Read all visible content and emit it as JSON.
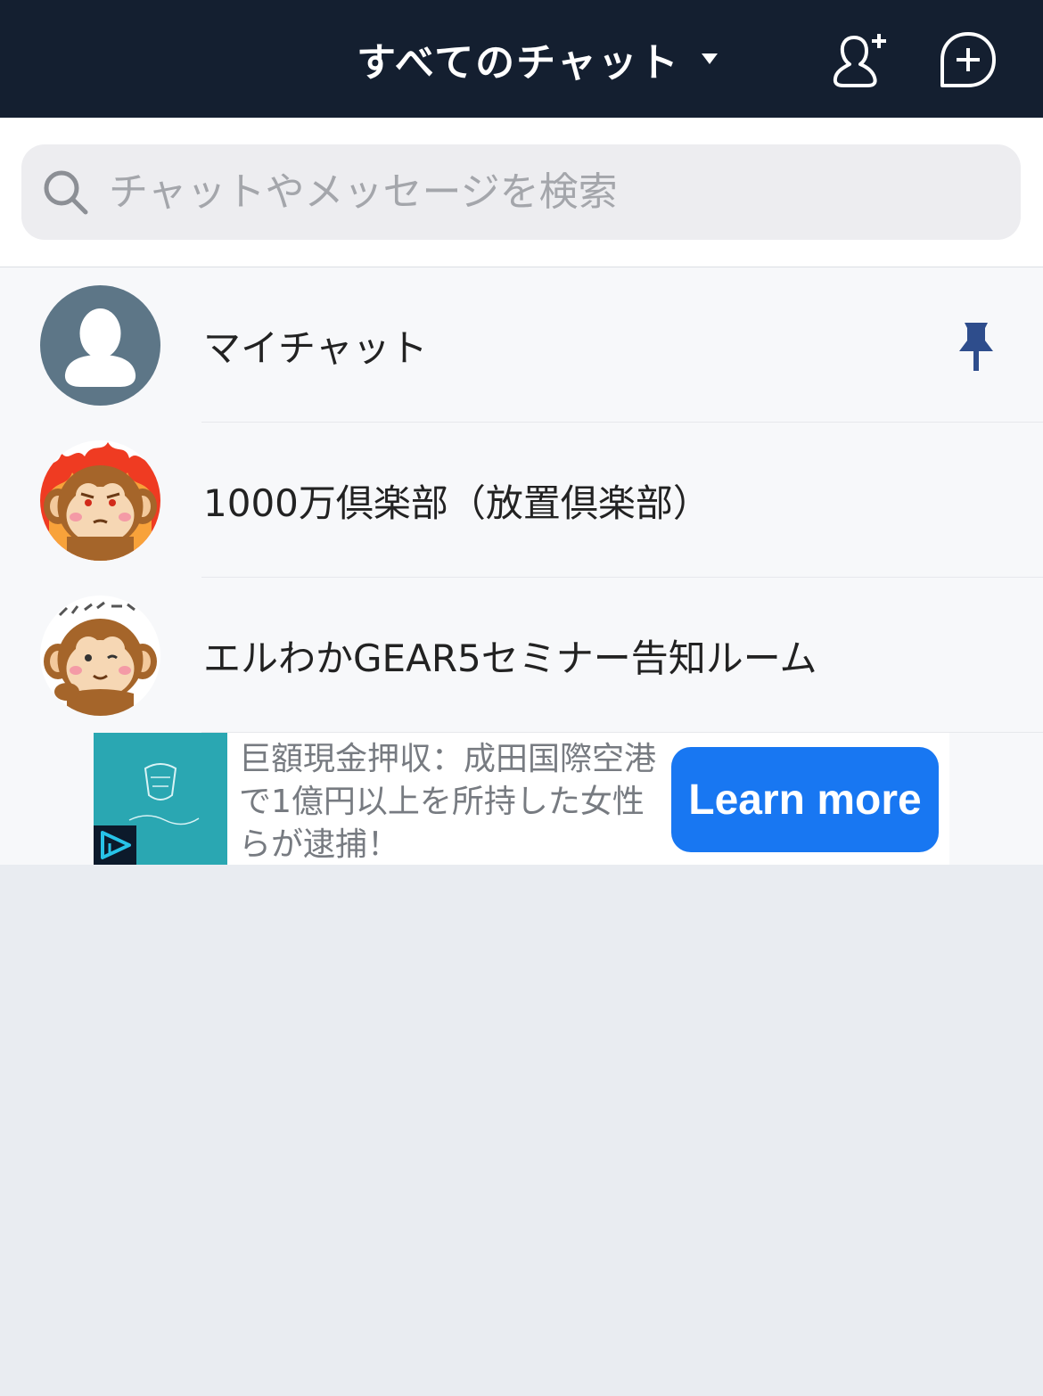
{
  "header": {
    "title": "すべてのチャット",
    "bg_color": "#141f30"
  },
  "search": {
    "placeholder": "チャットやメッセージを検索"
  },
  "chats": [
    {
      "name": "マイチャット",
      "avatar": "default-person-icon",
      "pinned": true
    },
    {
      "name": "1000万倶楽部（放置倶楽部）",
      "avatar": "angry-monkey-avatar",
      "pinned": false
    },
    {
      "name": "エルわかGEAR5セミナー告知ルーム",
      "avatar": "winking-monkey-avatar",
      "pinned": false
    }
  ],
  "ad": {
    "text": "巨額現金押収：成田国際空港で1億円以上を所持した女性らが逮捕！",
    "cta": "Learn more",
    "cta_color": "#1877f2"
  }
}
